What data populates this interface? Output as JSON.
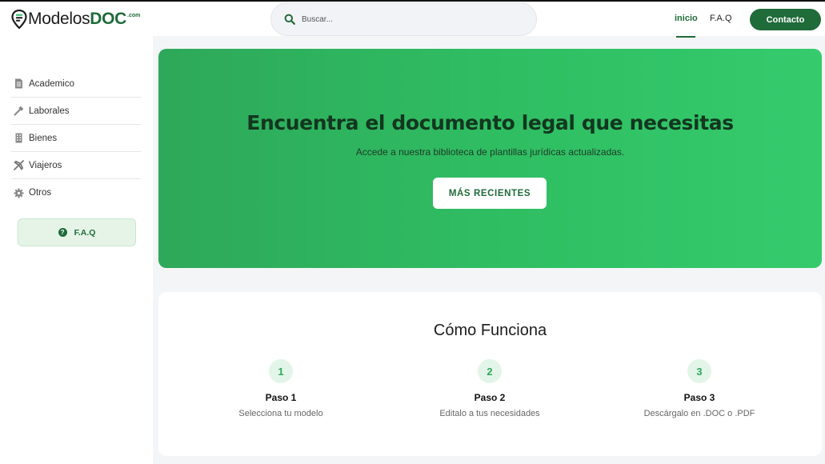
{
  "header": {
    "logo": {
      "main": "Modelos",
      "accent": "DOC",
      "suffix": ".com"
    },
    "search": {
      "placeholder": "Buscar...",
      "icon": "search-icon"
    },
    "nav": [
      {
        "label": "inicio",
        "active": true
      },
      {
        "label": "F.A.Q",
        "active": false
      }
    ],
    "contact_label": "Contacto"
  },
  "sidebar": {
    "items": [
      {
        "label": "Academico",
        "icon": "document-icon"
      },
      {
        "label": "Laborales",
        "icon": "hammer-icon"
      },
      {
        "label": "Bienes",
        "icon": "building-icon"
      },
      {
        "label": "Viajeros",
        "icon": "airplane-icon"
      },
      {
        "label": "Otros",
        "icon": "gear-icon"
      }
    ],
    "faq_label": "F.A.Q",
    "faq_icon": "question-icon"
  },
  "hero": {
    "title": "Encuentra el documento legal que necesitas",
    "subtitle": "Accede a nuestra biblioteca de plantillas jurídicas actualizadas.",
    "button_label": "MÁS RECIENTES"
  },
  "how": {
    "title": "Cómo Funciona",
    "steps": [
      {
        "number": "1",
        "title": "Paso 1",
        "description": "Selecciona tu modelo"
      },
      {
        "number": "2",
        "title": "Paso 2",
        "description": "Editalo a tus necesidades"
      },
      {
        "number": "3",
        "title": "Paso 3",
        "description": "Descárgalo en .DOC o .PDF"
      }
    ]
  },
  "colors": {
    "brand_dark": "#1f6b3a",
    "hero_green": "#2fbd62",
    "step_badge_bg": "#e3f5e8"
  }
}
